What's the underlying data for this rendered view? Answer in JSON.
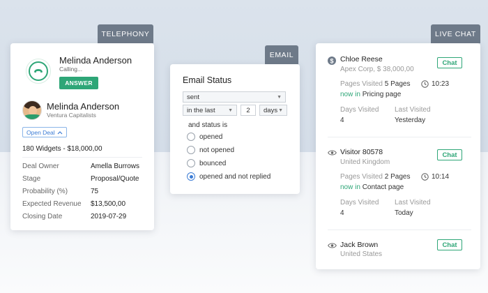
{
  "telephony": {
    "tab": "TELEPHONY",
    "caller_name": "Melinda Anderson",
    "calling_status": "Calling...",
    "answer_label": "ANSWER",
    "contact_name": "Melinda Anderson",
    "contact_company": "Ventura Capitalists",
    "open_deal_label": "Open Deal",
    "deal_title": "180 Widgets - $18,000,00",
    "deal_rows": [
      {
        "label": "Deal Owner",
        "value": "Amella Burrows"
      },
      {
        "label": "Stage",
        "value": "Proposal/Quote"
      },
      {
        "label": "Probability (%)",
        "value": "75"
      },
      {
        "label": "Expected Revenue",
        "value": "$13,500,00"
      },
      {
        "label": "Closing Date",
        "value": "2019-07-29"
      }
    ]
  },
  "email": {
    "tab": "EMAIL",
    "title": "Email Status",
    "status_select": "sent",
    "period_select": "in the last",
    "period_value": "2",
    "unit_select": "days",
    "status_label": "and status is",
    "options": [
      {
        "label": "opened",
        "selected": false
      },
      {
        "label": "not opened",
        "selected": false
      },
      {
        "label": "bounced",
        "selected": false
      },
      {
        "label": "opened and not replied",
        "selected": true
      }
    ]
  },
  "live_chat": {
    "tab": "LIVE CHAT",
    "chat_label": "Chat",
    "pages_visited_label": "Pages Visited",
    "now_in_label": "now in",
    "days_visited_label": "Days Visited",
    "last_visited_label": "Last Visited",
    "visitors": [
      {
        "icon": "dollar-icon",
        "name": "Chloe Reese",
        "sub": "Apex Corp, $ 38,000,00",
        "pages": "5 Pages",
        "current_page": "Pricing page",
        "time": "10:23",
        "days_visited": "4",
        "last_visited": "Yesterday"
      },
      {
        "icon": "eye-icon",
        "name": "Visitor 80578",
        "sub": "United Kingdom",
        "pages": "2 Pages",
        "current_page": "Contact page",
        "time": "10:14",
        "days_visited": "4",
        "last_visited": "Today"
      },
      {
        "icon": "eye-icon",
        "name": "Jack Brown",
        "sub": "United States"
      }
    ]
  },
  "colors": {
    "accent_green": "#2ea677",
    "accent_blue": "#3a7bd5",
    "tab_gray": "#6e7a89"
  }
}
